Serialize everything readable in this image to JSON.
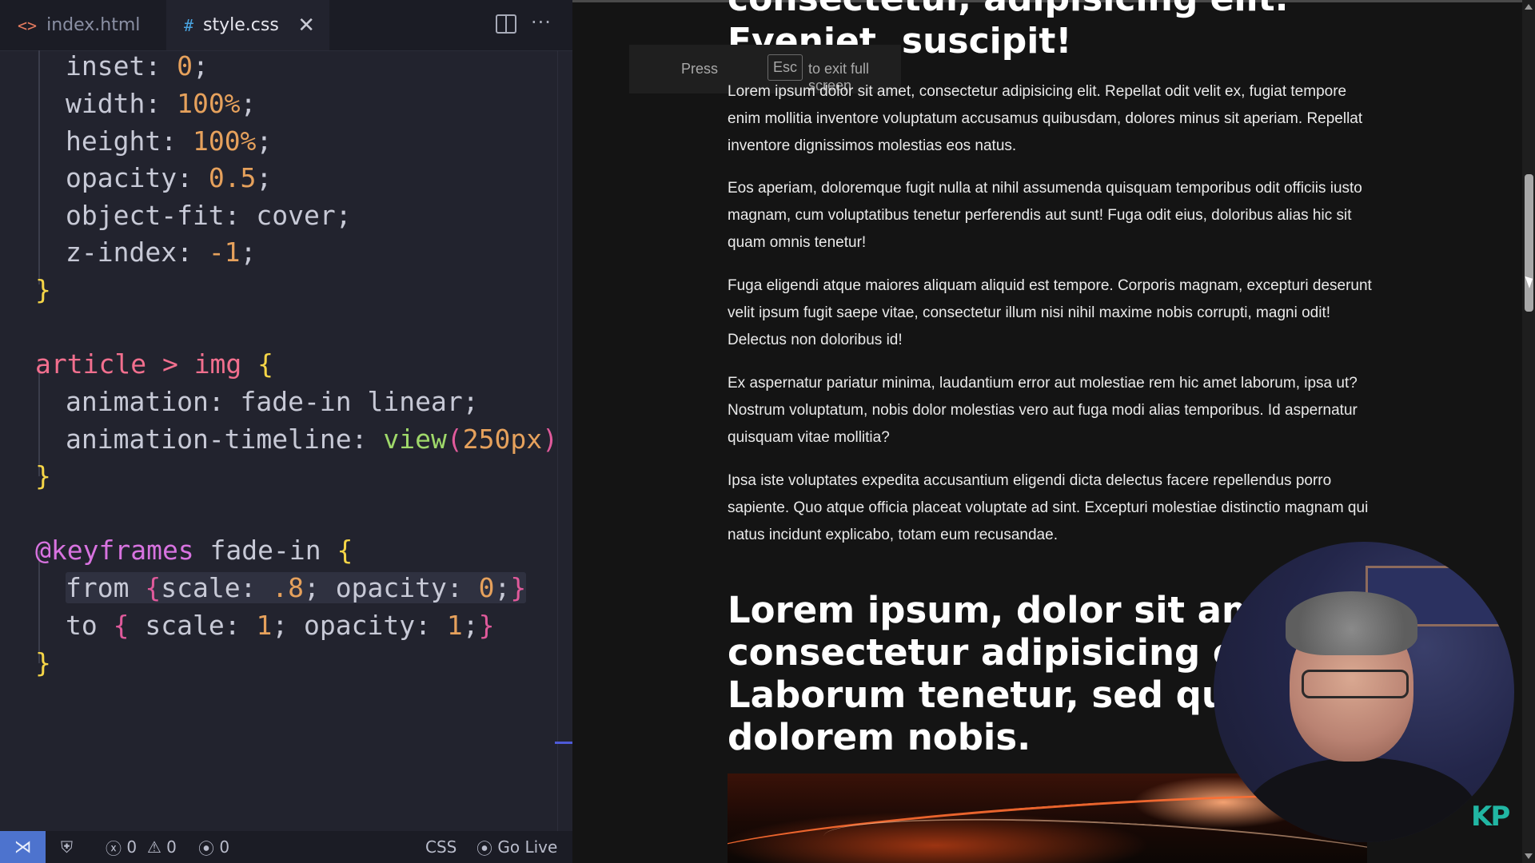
{
  "editor": {
    "tabs": [
      {
        "label": "index.html",
        "icon": "html-file-icon"
      },
      {
        "label": "style.css",
        "icon": "css-file-icon"
      }
    ],
    "close_glyph": "✕",
    "more_glyph": "···",
    "code": {
      "l1_prop": "inset: ",
      "l1_val": "0",
      "l1_end": ";",
      "l2_prop": "width: ",
      "l2_val": "100%",
      "l2_end": ";",
      "l3_prop": "height: ",
      "l3_val": "100%",
      "l3_end": ";",
      "l4_prop": "opacity: ",
      "l4_val": "0.5",
      "l4_end": ";",
      "l5": "object-fit: cover;",
      "l6_prop": "z-index: ",
      "l6_val": "-1",
      "l6_end": ";",
      "close1": "}",
      "rule2_sel1": "article",
      "rule2_op": " > ",
      "rule2_sel2": "img",
      "open": "{",
      "l8": "animation: fade-in linear;",
      "l9_a": "animation-timeline: ",
      "l9_fn": "view",
      "l9_p1": "(",
      "l9_val": "250px",
      "l9_p2": ")",
      "l9_end": ";",
      "close2": "}",
      "kf_kw": "@keyframes",
      "kf_name": " fade-in ",
      "kf_open": "{",
      "from_kw": "from ",
      "from_b1": "{",
      "from_a": "scale: ",
      "from_v1": ".8",
      "from_b": "; opacity: ",
      "from_v2": "0",
      "from_c": ";",
      "from_b2": "}",
      "to_kw": "to ",
      "to_b1": "{",
      "to_a": " scale: ",
      "to_v1": "1",
      "to_b": "; opacity: ",
      "to_v2": "1",
      "to_c": ";",
      "to_b2": "}",
      "close3": "}"
    }
  },
  "statusbar": {
    "errors": "0",
    "warnings": "0",
    "ports": "0",
    "language": "CSS",
    "go_live": "Go Live"
  },
  "preview": {
    "fullscreen_notice": {
      "press": "Press",
      "key": "Esc",
      "tail": "to exit full screen"
    },
    "heading_top": "consectetur, adipisicing elit.\nEveniet, suscipit!",
    "paragraphs": [
      "Lorem ipsum dolor sit amet, consectetur adipisicing elit. Repellat odit velit ex, fugiat tempore enim mollitia inventore voluptatum accusamus quibusdam, dolores minus sit aperiam. Repellat inventore dignissimos molestias eos natus.",
      "Eos aperiam, doloremque fugit nulla at nihil assumenda quisquam temporibus odit officiis iusto magnam, cum voluptatibus tenetur perferendis aut sunt! Fuga odit eius, doloribus alias hic sit quam omnis tenetur!",
      "Fuga eligendi atque maiores aliquam aliquid est tempore. Corporis magnam, excepturi deserunt velit ipsum fugit saepe vitae, consectetur illum nisi nihil maxime nobis corrupti, magni odit! Delectus non doloribus id!",
      "Ex aspernatur pariatur minima, laudantium error aut molestiae rem hic amet laborum, ipsa ut? Nostrum voluptatum, nobis dolor molestias vero aut fuga modi alias temporibus. Id aspernatur quisquam vitae mollitia?",
      "Ipsa iste voluptates expedita accusantium eligendi dicta delectus facere repellendus porro sapiente. Quo atque officia placeat voluptate ad sint. Excepturi molestiae distinctio magnam qui natus incidunt explicabo, totam eum recusandae."
    ],
    "heading_2": "Lorem ipsum, dolor sit amet\nconsectetur adipisicing elit.\nLaborum tenetur, sed quasi\ndolorem nobis.",
    "logo": "KP"
  },
  "colors": {
    "editor_bg": "#22232e",
    "selector": "#f26f8e",
    "number": "#e6a15c",
    "brace": "#f5d547",
    "keyword": "#d873e0",
    "function": "#9fd86a",
    "status_remote": "#4d73ce",
    "logo": "#21b6a3"
  }
}
